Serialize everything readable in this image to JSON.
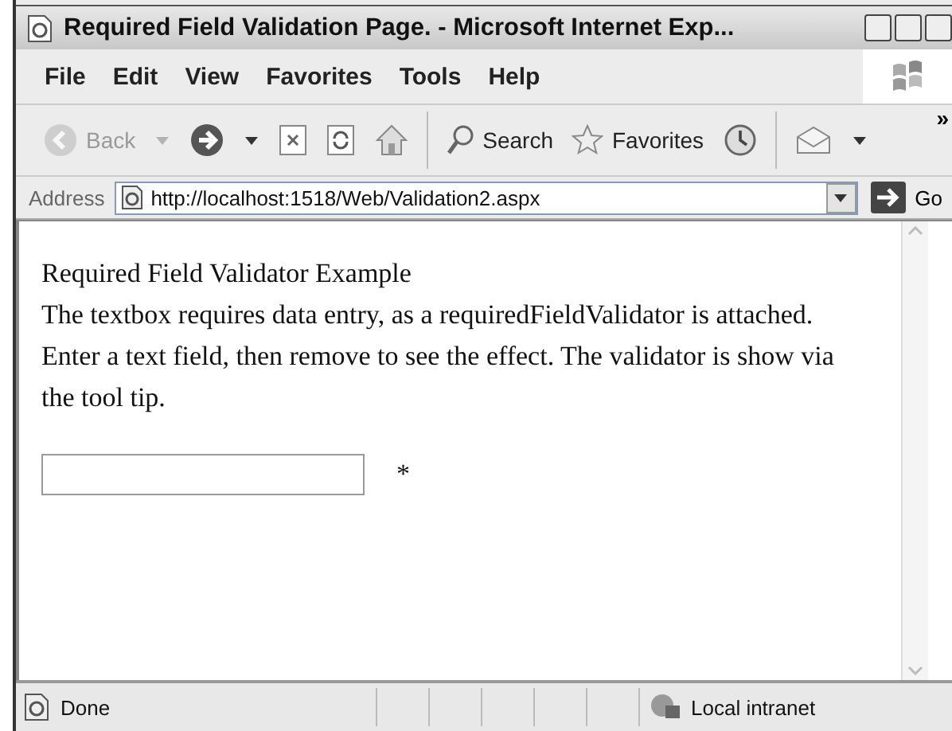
{
  "window": {
    "title": "Required Field Validation Page. - Microsoft Internet Exp..."
  },
  "menu": [
    "File",
    "Edit",
    "View",
    "Favorites",
    "Tools",
    "Help"
  ],
  "toolbar": [
    {
      "kind": "back",
      "label": "Back",
      "disabled": true
    },
    {
      "kind": "forward",
      "disabled": false
    },
    {
      "kind": "stop",
      "disabled": false
    },
    {
      "kind": "refresh",
      "disabled": false
    },
    {
      "kind": "home",
      "disabled": false
    },
    {
      "kind": "search",
      "label": "Search",
      "disabled": false
    },
    {
      "kind": "favorites",
      "label": "Favorites",
      "disabled": false
    },
    {
      "kind": "history",
      "disabled": false
    },
    {
      "kind": "mail",
      "disabled": false
    }
  ],
  "toolbar_overflow": "»",
  "address": {
    "label": "Address",
    "value": "http://localhost:1518/Web/Validation2.aspx",
    "go": "Go"
  },
  "page": {
    "heading": "Required Field Validator Example",
    "text": "The textbox requires data entry, as a requiredFieldValidator is attached. Enter a text field, then remove to see the effect. The validator is show via the tool tip.",
    "marker": "*"
  },
  "status": {
    "text": "Done",
    "zone": "Local intranet"
  }
}
